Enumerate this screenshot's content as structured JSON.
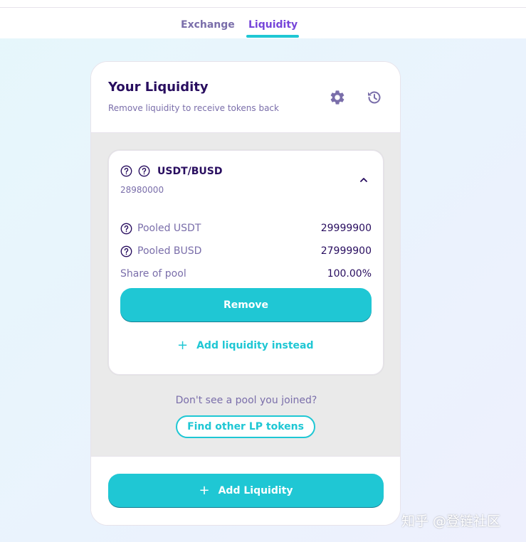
{
  "nav": {
    "tabs": [
      {
        "label": "Exchange",
        "active": false
      },
      {
        "label": "Liquidity",
        "active": true
      }
    ]
  },
  "header": {
    "title": "Your Liquidity",
    "subtitle": "Remove liquidity to receive tokens back",
    "icons": [
      "gear-icon",
      "history-icon"
    ]
  },
  "pool": {
    "pair": "USDT/BUSD",
    "balance": "28980000",
    "rows": [
      {
        "label": "Pooled USDT",
        "value": "29999900"
      },
      {
        "label": "Pooled BUSD",
        "value": "27999900"
      },
      {
        "label": "Share of pool",
        "value": "100.00%"
      }
    ],
    "remove_label": "Remove",
    "add_instead_label": "Add liquidity instead"
  },
  "footer_prompt": {
    "text": "Don't see a pool you joined?",
    "find_label": "Find other LP tokens"
  },
  "actions": {
    "add_liquidity_label": "Add Liquidity"
  },
  "watermark": "知乎 @登链社区",
  "colors": {
    "primary": "#1fc7d4",
    "secondary": "#7645d9",
    "text": "#280d5f",
    "text_subtle": "#7a6eaa"
  }
}
